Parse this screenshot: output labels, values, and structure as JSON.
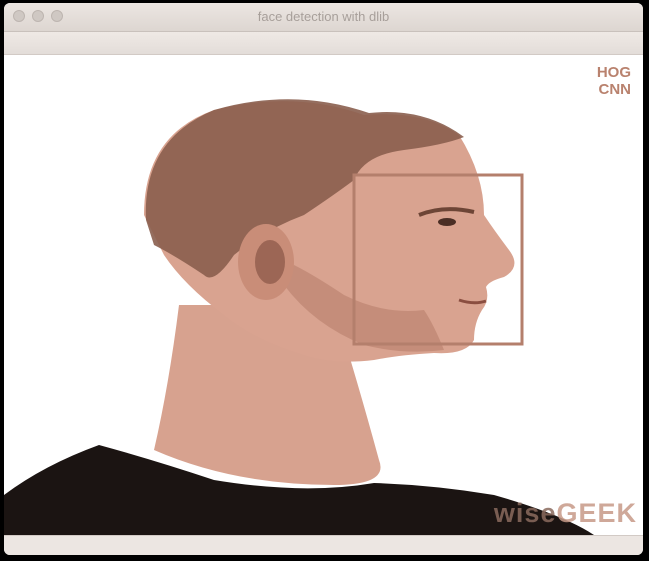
{
  "window": {
    "title": "face detection with dlib"
  },
  "legend": {
    "items": [
      "HOG",
      "CNN"
    ],
    "color": "#b9826e"
  },
  "detection": {
    "box_color": "#b47f6c"
  },
  "watermark": {
    "part1": "wise",
    "part2": "GEEK"
  },
  "colors": {
    "skin": "#d9a390",
    "skin_shadow": "#b57c68",
    "hair": "#7d5445",
    "shirt": "#1b1412",
    "background": "#ffffff"
  }
}
